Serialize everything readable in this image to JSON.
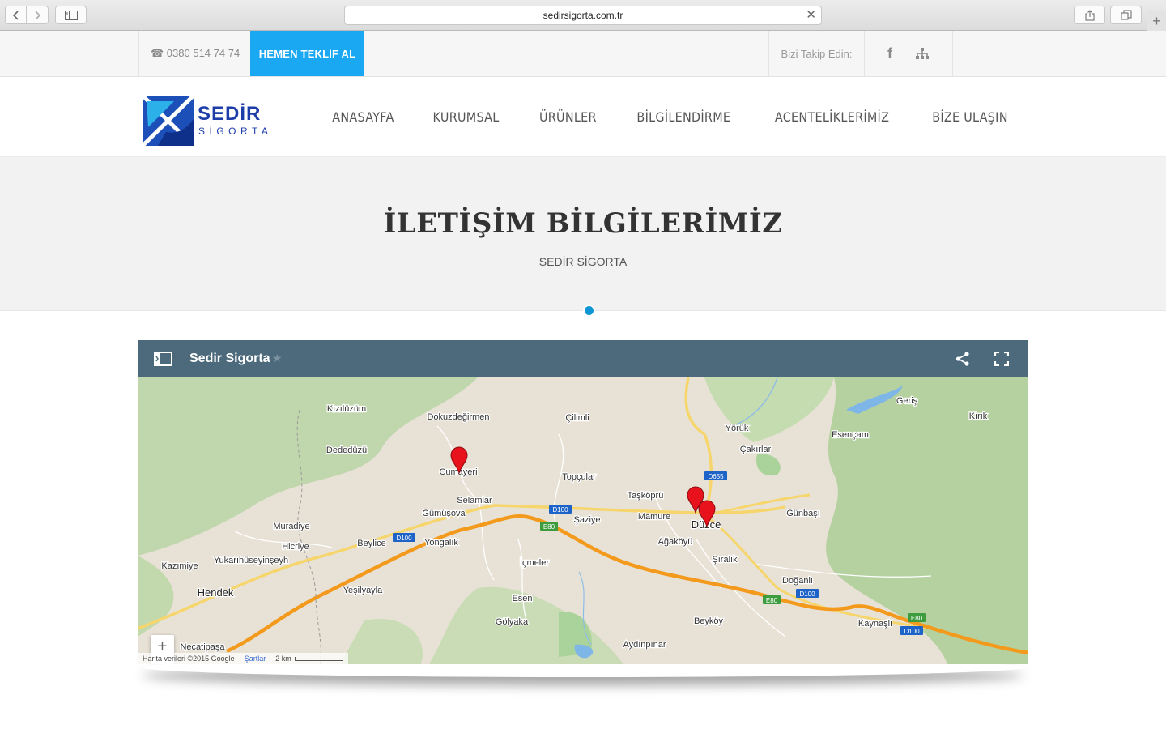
{
  "browser": {
    "url": "sedirsigorta.com.tr",
    "back_icon": "chevron-left-icon",
    "forward_icon": "chevron-right-icon"
  },
  "topbar": {
    "phone": "☎ 0380 514 74 74",
    "cta": "HEMEN TEKLİF AL",
    "follow": "Bizi Takip Edin:",
    "facebook": "f"
  },
  "logo": {
    "title": "SEDİR",
    "subtitle": "SİGORTA"
  },
  "nav": [
    "ANASAYFA",
    "KURUMSAL",
    "ÜRÜNLER",
    "BİLGİLENDİRME",
    "ACENTELİKLERİMİZ",
    "BİZE ULAŞIN"
  ],
  "page": {
    "title": "İLETİŞİM BİLGİLERİMİZ",
    "subtitle": "SEDİR SİGORTA"
  },
  "map": {
    "title": "Sedir Sigorta",
    "attribution": "Harita verileri ©2015 Google",
    "terms": "Şartlar",
    "scale": "2 km",
    "places": [
      "Kızılüzüm",
      "Dokuzdeğirmen",
      "Dededüzü",
      "Cumayeri",
      "Çilimli",
      "Yörük",
      "Çakırlar",
      "Esençam",
      "Geriş",
      "Kırık",
      "Topçular",
      "Taşköprü",
      "Selamlar",
      "Gümüşova",
      "Mamure",
      "Düzce",
      "Şaziye",
      "Günbaşı",
      "Muradiye",
      "Beylice",
      "Yongalık",
      "Ağaköyü",
      "Hicriye",
      "Yukarıhüseyinşeyh",
      "Şıralık",
      "Kazımiye",
      "İçmeler",
      "Doğanlı",
      "Hendek",
      "Yeşilyayla",
      "Esen",
      "Gölyaka",
      "Beyköy",
      "Kaynaşlı",
      "Necatipaşa",
      "Aydınpınar"
    ],
    "road_labels": [
      "D655",
      "D100",
      "D100",
      "E80",
      "D100",
      "E80",
      "E80",
      "D100"
    ],
    "zoom_in": "+",
    "zoom_out": "−"
  }
}
